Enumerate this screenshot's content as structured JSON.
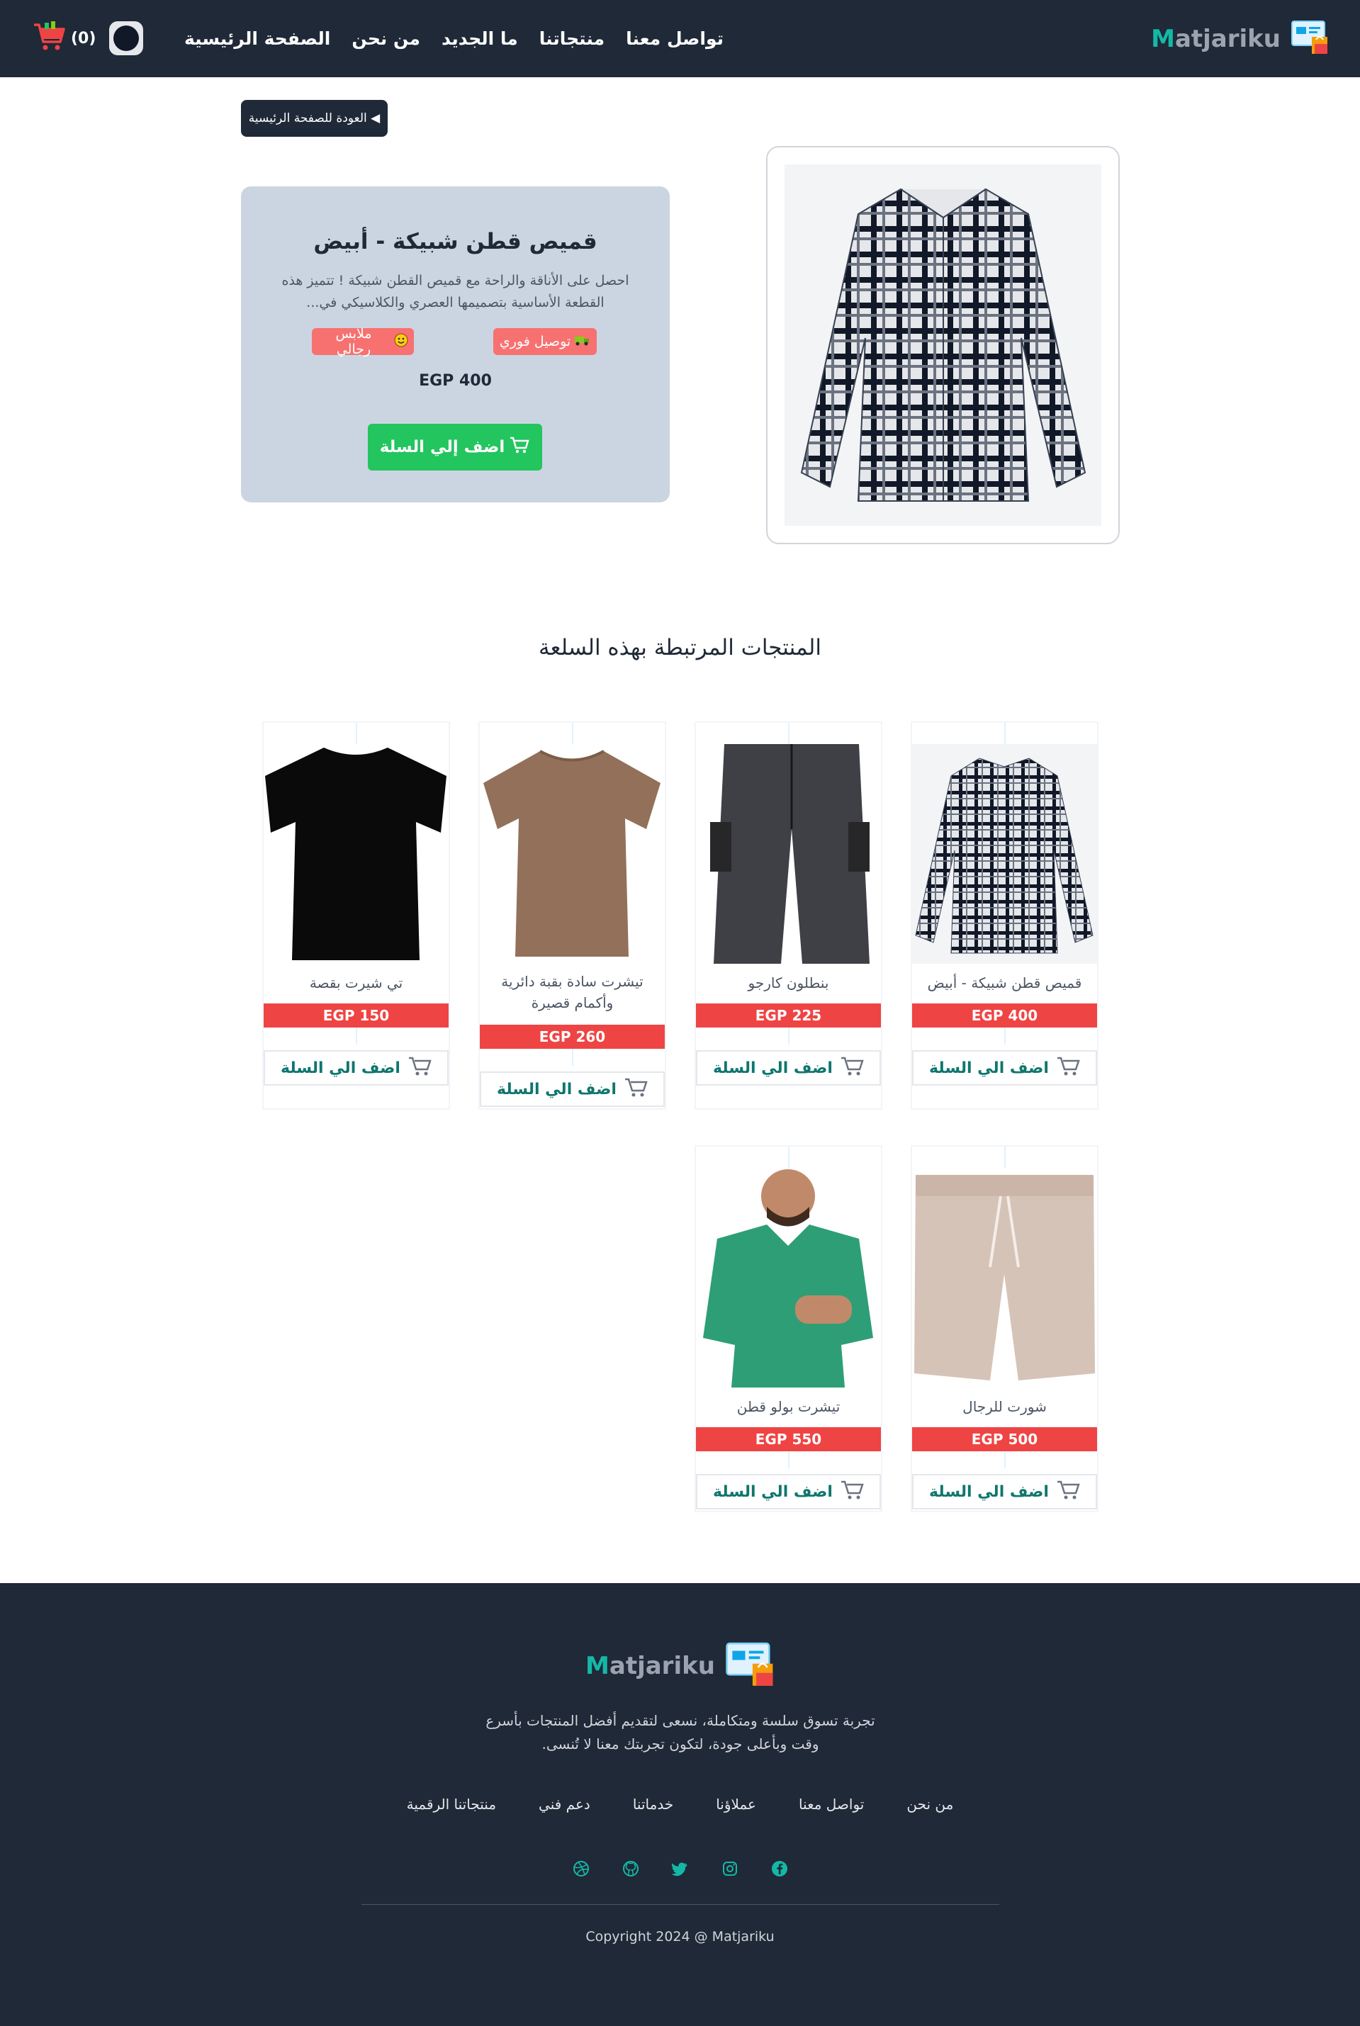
{
  "nav": {
    "cart_count": "(0)",
    "links": [
      "الصفحة الرئيسية",
      "من نحن",
      "ما الجديد",
      "منتجاتنا",
      "تواصل معنا"
    ],
    "brand_lead": "M",
    "brand_rest": "atjariku"
  },
  "back_button": "العودة للصفحة الرئيسية ◀",
  "product": {
    "title": "قميص قطن شبيكة - أبيض",
    "description": "احصل على الأناقة والراحة مع قميص القطن شبيكة ! تتميز هذه القطعة الأساسية بتصميمها العصري والكلاسيكي في...",
    "badge_delivery": "توصيل فوري",
    "badge_category": "ملابس رجالي",
    "price": "EGP 400",
    "add_to_cart": "اضف إلي السلة"
  },
  "related": {
    "title": "المنتجات المرتبطة بهذه السلعة",
    "add_label": "اضف الي السلة",
    "items": [
      {
        "name": "قميص قطن شبيكة - أبيض",
        "price": "EGP 400",
        "image": "plaid-shirt"
      },
      {
        "name": "بنطلون كارجو",
        "price": "EGP 225",
        "image": "cargo-pants"
      },
      {
        "name": "تيشرت سادة بقبة دائرية وأكمام قصيرة",
        "price": "EGP 260",
        "image": "brown-tshirt"
      },
      {
        "name": "تي شيرت بقصة",
        "price": "EGP 150",
        "image": "black-tshirt"
      },
      {
        "name": "شورت للرجال",
        "price": "EGP 500",
        "image": "beige-shorts"
      },
      {
        "name": "تيشرت بولو قطن",
        "price": "EGP 550",
        "image": "green-polo"
      }
    ]
  },
  "footer": {
    "description": "تجربة تسوق سلسة ومتكاملة، نسعى لتقديم أفضل المنتجات بأسرع وقت وبأعلى جودة، لتكون تجربتك معنا لا تُنسى.",
    "links": [
      "من نحن",
      "تواصل معنا",
      "عملاؤنا",
      "خدماتنا",
      "دعم فني",
      "منتجاتنا الرقمية"
    ],
    "copyright": "Copyright 2024 @ Matjariku",
    "social_icons": [
      "facebook-icon",
      "instagram-icon",
      "twitter-icon",
      "github-icon",
      "dribbble-icon"
    ]
  },
  "colors": {
    "navbar": "#1f2937",
    "brand_accent": "#14b8a6",
    "price_badge": "#ef4444",
    "add_button": "#22c55e",
    "info_card": "#cbd5e1"
  }
}
